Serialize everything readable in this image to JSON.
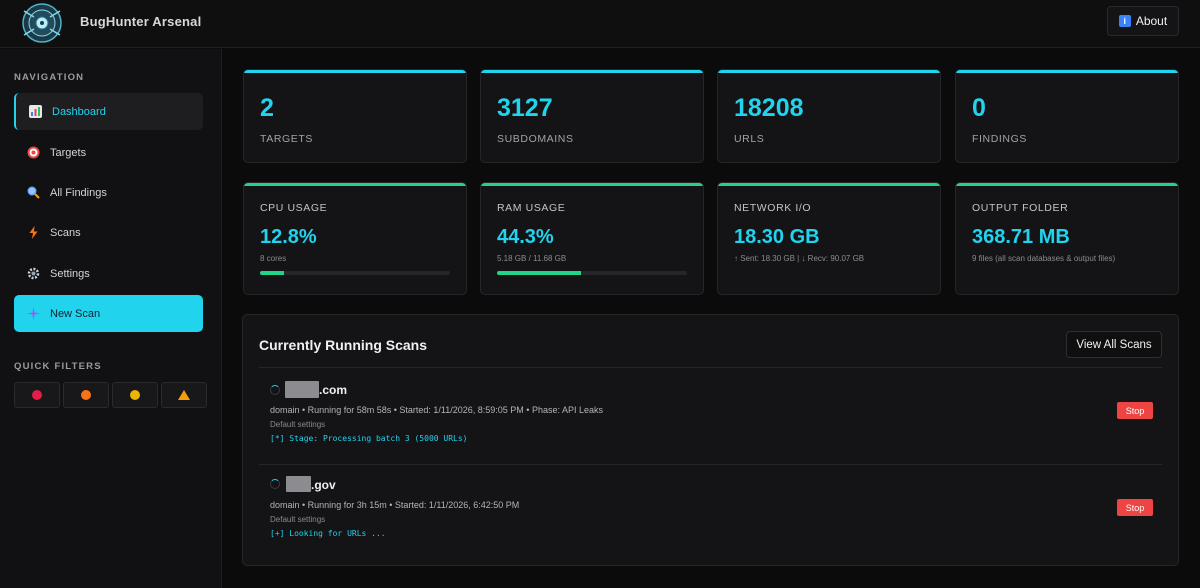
{
  "header": {
    "app_title": "BugHunter Arsenal",
    "about_label": "About"
  },
  "sidebar": {
    "nav_label": "NAVIGATION",
    "items": [
      {
        "label": "Dashboard",
        "icon": "chart-icon"
      },
      {
        "label": "Targets",
        "icon": "target-icon"
      },
      {
        "label": "All Findings",
        "icon": "search-icon"
      },
      {
        "label": "Scans",
        "icon": "lightning-icon"
      },
      {
        "label": "Settings",
        "icon": "gear-icon"
      },
      {
        "label": "New Scan",
        "icon": "sparkle-icon"
      }
    ],
    "filters_label": "QUICK FILTERS",
    "filters": [
      {
        "icon": "red-dot-icon",
        "color": "#e11d48"
      },
      {
        "icon": "orange-dot-icon",
        "color": "#f97316"
      },
      {
        "icon": "yellow-dot-icon",
        "color": "#eab308"
      },
      {
        "icon": "warning-icon",
        "color": "#f59e0b"
      }
    ]
  },
  "stats": [
    {
      "value": "2",
      "label": "TARGETS"
    },
    {
      "value": "3127",
      "label": "SUBDOMAINS"
    },
    {
      "value": "18208",
      "label": "URLS"
    },
    {
      "value": "0",
      "label": "FINDINGS"
    }
  ],
  "resources": [
    {
      "label": "CPU USAGE",
      "value": "12.8%",
      "sub": "8 cores",
      "percent": 12.8
    },
    {
      "label": "RAM USAGE",
      "value": "44.3%",
      "sub": "5.18 GB / 11.68 GB",
      "percent": 44.3
    },
    {
      "label": "NETWORK I/O",
      "value": "18.30 GB",
      "sub": "↑ Sent: 18.30 GB | ↓ Recv: 90.07 GB"
    },
    {
      "label": "OUTPUT FOLDER",
      "value": "368.71 MB",
      "sub": "9 files (all scan databases & output files)"
    }
  ],
  "running": {
    "title": "Currently Running Scans",
    "view_all_label": "View All Scans",
    "scans": [
      {
        "name": ".com",
        "meta": "domain • Running for 58m 58s • Started: 1/11/2026, 8:59:05 PM • Phase: API Leaks",
        "setting": "Default settings",
        "log": "[*] Stage: Processing batch 3 (5000 URLs)",
        "stop_label": "Stop"
      },
      {
        "name": ".gov",
        "meta": "domain • Running for 3h 15m • Started: 1/11/2026, 6:42:50 PM",
        "setting": "Default settings",
        "log": "[+] Looking for URLs ...",
        "stop_label": "Stop"
      }
    ]
  },
  "colors": {
    "accent": "#22d3ee",
    "accent_green": "#22d38a",
    "danger": "#ef4444"
  }
}
